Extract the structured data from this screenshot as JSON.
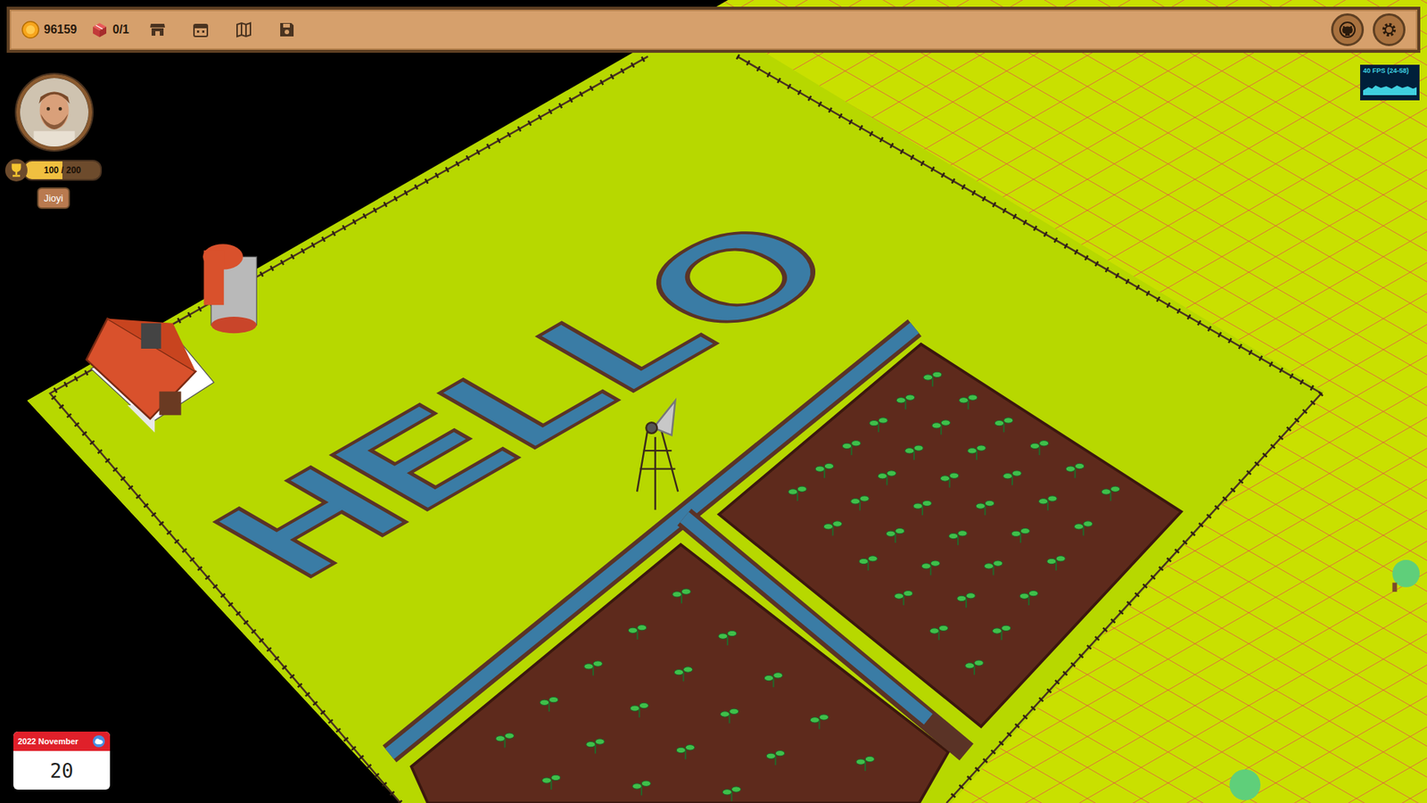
{
  "hud": {
    "coins": "96159",
    "crates": "0/1",
    "fps": "40 FPS (24-58)"
  },
  "player": {
    "name": "Jioyi",
    "xp": "100 / 200",
    "level": 0.5
  },
  "calendar": {
    "month": "2022 November",
    "day": "20"
  },
  "field": {
    "sign": "HELLO"
  }
}
